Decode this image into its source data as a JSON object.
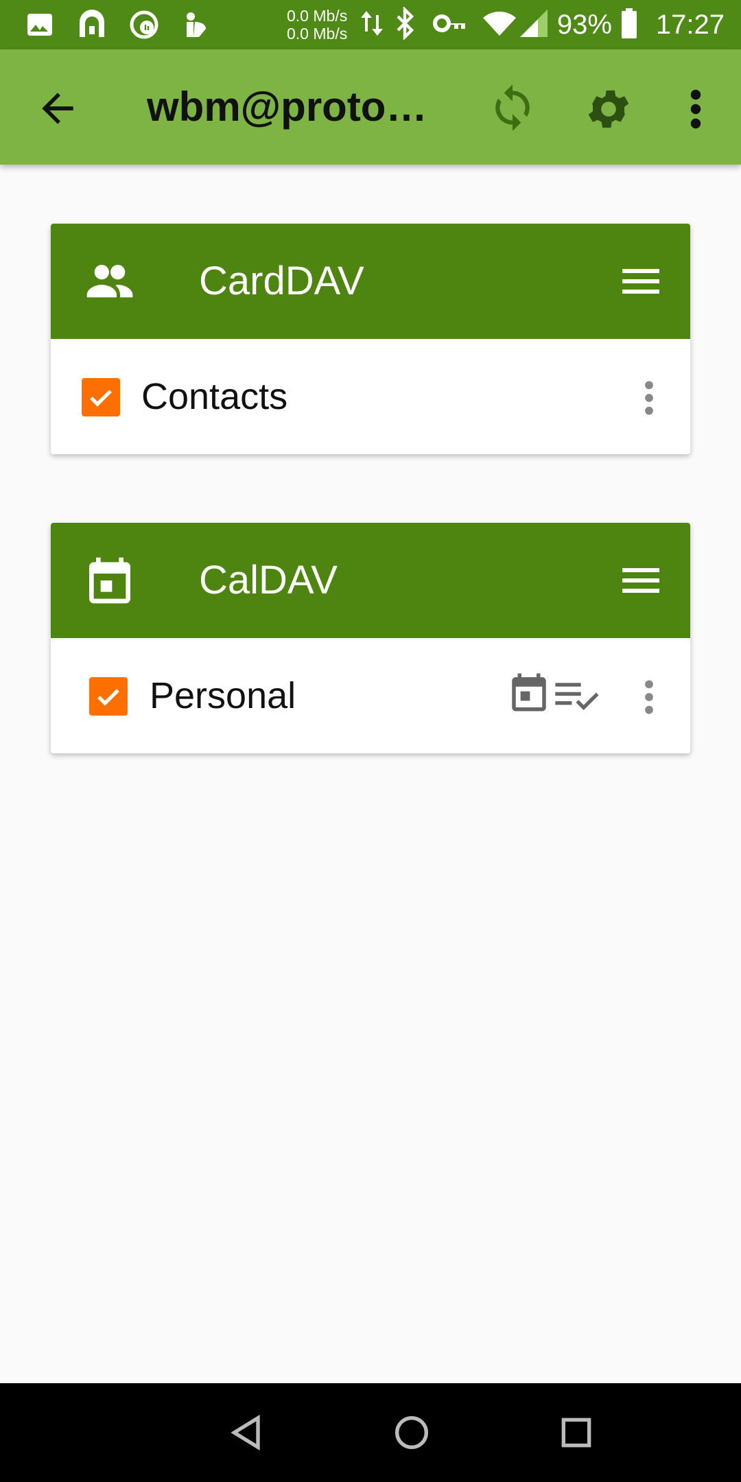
{
  "status_bar": {
    "net_up": "0.0 Mb/s",
    "net_down": "0.0 Mb/s",
    "battery": "93%",
    "time": "17:27",
    "icons": [
      "image-icon",
      "vpn-arch-icon",
      "podcast-icon",
      "reddit-icon",
      "data-arrows-icon",
      "bluetooth-icon",
      "key-icon",
      "wifi-icon",
      "signal-icon",
      "battery-icon"
    ]
  },
  "appbar": {
    "title": "wbm@proton…",
    "icons": [
      "back-arrow-icon",
      "sync-icon",
      "settings-gear-icon",
      "overflow-menu-icon"
    ]
  },
  "sections": [
    {
      "title": "CardDAV",
      "icon": "contacts-group-icon",
      "items": [
        {
          "label": "Contacts",
          "checked": true
        }
      ]
    },
    {
      "title": "CalDAV",
      "icon": "calendar-icon",
      "items": [
        {
          "label": "Personal",
          "checked": true,
          "badges": [
            "calendar-icon",
            "tasks-icon"
          ]
        }
      ]
    }
  ],
  "colors": {
    "status_bar": "#4e8a15",
    "app_bar": "#7db443",
    "card_header": "#4e8510",
    "checkbox": "#ff6f00",
    "background": "#fafafa"
  }
}
